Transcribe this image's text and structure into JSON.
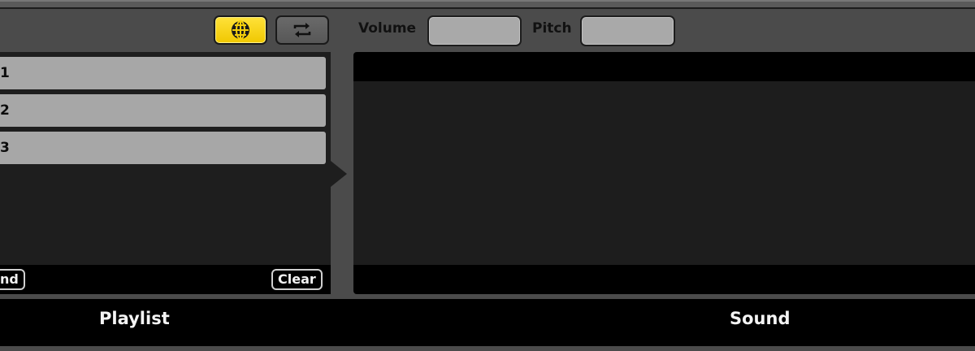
{
  "toolbar": {
    "globe_icon": "globe-icon",
    "loop_icon": "repeat-icon",
    "volume_label": "Volume",
    "volume_value": "",
    "pitch_label": "Pitch",
    "pitch_value": ""
  },
  "playlist": {
    "items": [
      {
        "label": "1"
      },
      {
        "label": "2"
      },
      {
        "label": "3"
      }
    ],
    "left_button_label": "nd",
    "clear_label": "Clear",
    "title": "Playlist"
  },
  "sound": {
    "title": "Sound"
  },
  "colors": {
    "accent": "#f5cf0b",
    "panel": "#1e1e1e",
    "row": "#a7a7a7",
    "background": "#4b4b4b"
  }
}
